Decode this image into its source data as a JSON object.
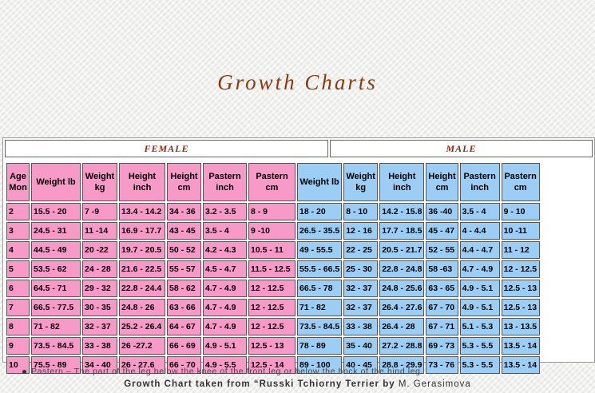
{
  "title": "Growth Charts",
  "sections": {
    "female": "FEMALE",
    "male": "MALE"
  },
  "headers": [
    "Age Mon",
    "Weight lb",
    "Weight kg",
    "Height inch",
    "Height cm",
    "Pastern inch",
    "Pastern cm",
    "Weight lb",
    "Weight kg",
    "Height inch",
    "Height cm",
    "Pastern inch",
    "Pastern cm"
  ],
  "rows": [
    [
      "2",
      "15.5 - 20",
      "7 -9",
      "13.4 - 14.2",
      "34 - 36",
      "3.2 - 3.5",
      "8 - 9",
      "18 - 20",
      "8 - 10",
      "14.2 - 15.8",
      "36 -40",
      "3.5 - 4",
      "9 - 10"
    ],
    [
      "3",
      "24.5 - 31",
      "11 -14",
      "16.9 - 17.7",
      "43 - 45",
      "3.5 - 4",
      "9 -10",
      "26.5 - 35.5",
      "12 - 16",
      "17.7 - 18.5",
      "45 - 47",
      "4 - 4.4",
      "10 -11"
    ],
    [
      "4",
      "44.5 - 49",
      "20 -22",
      "19.7 - 20.5",
      "50 - 52",
      "4.2 - 4.3",
      "10.5 - 11",
      "49 - 55.5",
      "22 - 25",
      "20.5 - 21.7",
      "52 - 55",
      "4.4 - 4.7",
      "11 - 12"
    ],
    [
      "5",
      "53.5 - 62",
      "24 - 28",
      "21.6 - 22.5",
      "55 - 57",
      "4.5 - 4.7",
      "11.5 - 12.5",
      "55.5 - 66.5",
      "25 - 30",
      "22.8 - 24.8",
      "58 -63",
      "4.7 - 4.9",
      "12 - 12.5"
    ],
    [
      "6",
      "64.5 - 71",
      "29 - 32",
      "22.8 - 24.4",
      "58 - 62",
      "4.7 - 4.9",
      "12 - 12.5",
      "66.5 - 78",
      "32 - 37",
      "24.8 - 25.6",
      "63 - 65",
      "4.9 - 5.1",
      "12.5 - 13"
    ],
    [
      "7",
      "66.5 - 77.5",
      "30 - 35",
      "24.8 - 26",
      "63 - 66",
      "4.7 - 4.9",
      "12 - 12.5",
      "71 - 82",
      "32 - 37",
      "26.4 - 27.6",
      "67 - 70",
      "4.9 - 5.1",
      "12.5 - 13"
    ],
    [
      "8",
      "71 - 82",
      "32 - 37",
      "25.2 - 26.4",
      "64 - 67",
      "4.7 - 4.9",
      "12 - 12.5",
      "73.5 - 84.5",
      "33 - 38",
      "26.4 - 28",
      "67 - 71",
      "5.1 - 5.3",
      "13 - 13.5"
    ],
    [
      "9",
      "73.5 - 84.5",
      "33 - 38",
      "26 -27.2",
      "66 - 69",
      "4.9 - 5.1",
      "12.5 - 13",
      "78 - 89",
      "35 - 40",
      "27.2 - 28.8",
      "69 - 73",
      "5.3 - 5.5",
      "13.5 - 14"
    ],
    [
      "10",
      "75.5 - 89",
      "34 - 40",
      "26 - 27.6",
      "66 - 70",
      "4.9 - 5.5",
      "12.5 - 14",
      "89 - 100",
      "40 - 45",
      "28.8 - 29.9",
      "73 - 76",
      "5.3 - 5.5",
      "13.5 - 14"
    ]
  ],
  "note": "Pastern – The part of the leg below the knee of the front leg or below the hock of the hind leg.",
  "source": {
    "prefix": "Growth Chart taken from “Russki Tchiorny Terrier by",
    "author": "M. Gerasimova"
  },
  "colors": {
    "female": "#f79ac8",
    "male": "#9ccdf5",
    "title": "#8b3a10"
  }
}
